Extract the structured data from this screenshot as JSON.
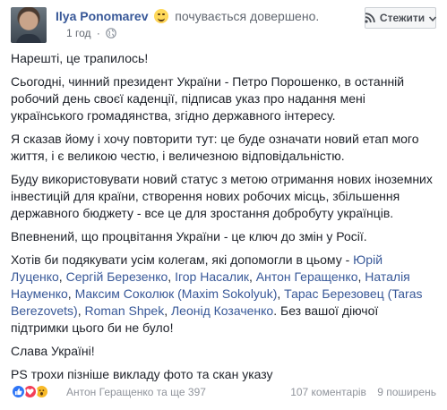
{
  "header": {
    "author": "Ilya Ponomarev",
    "feeling": "почувається довершено.",
    "time": "1 год",
    "sep": "·",
    "follow_label": "Стежити"
  },
  "post": {
    "p1": "Нарешті, це трапилось!",
    "p2": "Сьогодні, чинний президент України - Петро Порошенко, в останній робочий день своєї каденції, підписав указ про надання мені українського громадянства, згідно державного інтересу.",
    "p3": "Я сказав йому і хочу повторити тут: це буде означати новий етап мого життя, і є великою честю, і величезною відповідальністю.",
    "p4": "Буду використовувати новий статус з метою отримання нових іноземних інвестицій для країни, створення нових робочих місць, збільшення державного бюджету - все це для зростання добробуту українців.",
    "p5": "Впевнений, що процвітання України - це ключ до змін у Росії.",
    "p6_intro": "Хотів би подякувати усім колегам, які допомогли в цьому -",
    "mentions": [
      "Юрій Луценко",
      "Сергій Березенко",
      "Ігор Насалик",
      "Антон Геращенко",
      "Наталія Науменко",
      "Максим Соколюк (Maxim Sokolyuk)",
      "Тарас Березовец (Taras Berezovets)",
      "Roman Shpek",
      "Леонід Козаченко"
    ],
    "p6_outro": "Без вашої діючої підтримки цього би не було!",
    "p7": "Слава Україні!",
    "p8": "PS трохи пізніше викладу фото та скан указу"
  },
  "footer": {
    "reactors": "Антон Геращенко та ще 397",
    "comments": "107 коментарів",
    "shares": "9 поширень"
  },
  "colors": {
    "link": "#385898",
    "text": "#1d2129",
    "meta": "#616770",
    "like": "#2e75f6",
    "love": "#f33e58",
    "wow": "#f7b928"
  }
}
